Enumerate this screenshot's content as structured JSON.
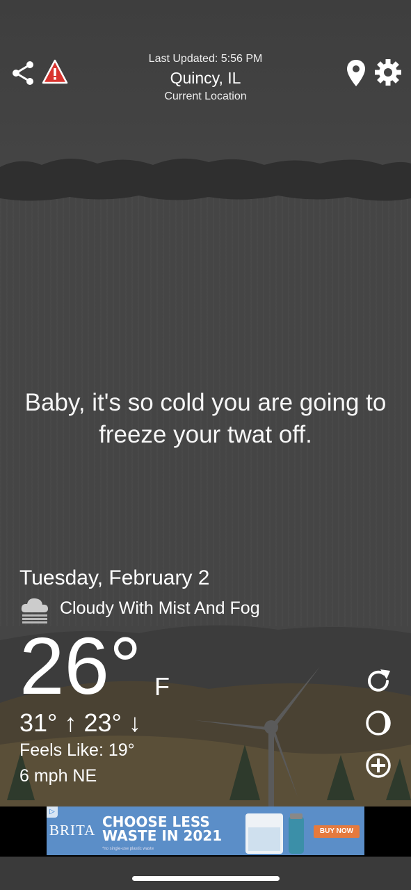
{
  "header": {
    "last_updated": "Last Updated: 5:56 PM",
    "city": "Quincy, IL",
    "location_label": "Current Location"
  },
  "icons": {
    "share": "share-icon",
    "alert": "warning-icon",
    "location": "location-pin-icon",
    "settings": "gear-icon",
    "refresh": "refresh-icon",
    "moon": "moon-phase-icon",
    "add": "add-circle-icon",
    "condition": "cloud-fog-icon"
  },
  "quote": "Baby, it's so cold you are going to freeze your twat off.",
  "weather": {
    "date": "Tuesday, February 2",
    "condition": "Cloudy With Mist And Fog",
    "temperature": "26°",
    "unit": "F",
    "high": "31°",
    "low": "23°",
    "feels_like": "Feels Like: 19°",
    "wind": "6 mph NE"
  },
  "ad": {
    "brand": "BRITA",
    "headline_line1": "CHOOSE LESS",
    "headline_line2": "WASTE IN 2021",
    "fine_print": "*no single-use plastic waste",
    "cta": "BUY NOW"
  },
  "colors": {
    "background": "#454545",
    "ad_background": "#5b8ec8",
    "cta": "#e57a3e",
    "alert_red": "#d8342f"
  }
}
